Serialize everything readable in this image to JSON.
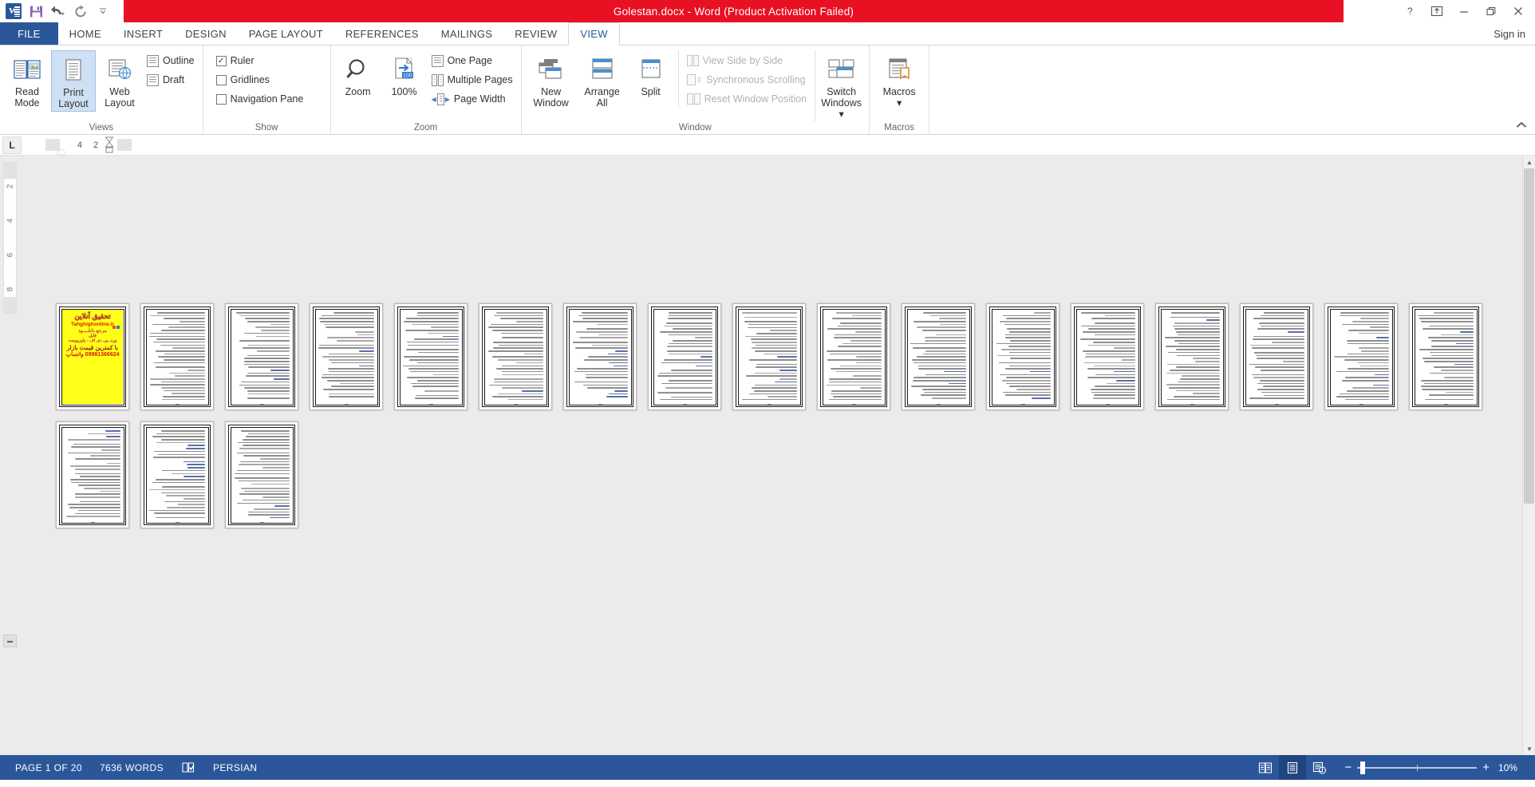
{
  "window": {
    "title": "Golestan.docx  -  Word (Product Activation Failed)",
    "accent_red": "#e81123",
    "accent_blue": "#2b579a",
    "quick_access": [
      {
        "name": "word-logo",
        "label": "W"
      },
      {
        "name": "save-icon",
        "label": "Save"
      },
      {
        "name": "undo-icon",
        "label": "Undo"
      },
      {
        "name": "redo-icon",
        "label": "Redo"
      },
      {
        "name": "customize-qat-icon",
        "label": "Customize Quick Access Toolbar"
      }
    ],
    "controls": [
      {
        "name": "help-button",
        "label": "?"
      },
      {
        "name": "ribbon-display-options-button",
        "label": "Ribbon Display Options"
      },
      {
        "name": "minimize-button",
        "label": "Minimize"
      },
      {
        "name": "restore-button",
        "label": "Restore Down"
      },
      {
        "name": "close-button",
        "label": "Close"
      }
    ],
    "sign_in": "Sign in"
  },
  "tabs": [
    {
      "label": "FILE",
      "active": false,
      "file": true
    },
    {
      "label": "HOME",
      "active": false
    },
    {
      "label": "INSERT",
      "active": false
    },
    {
      "label": "DESIGN",
      "active": false
    },
    {
      "label": "PAGE LAYOUT",
      "active": false
    },
    {
      "label": "REFERENCES",
      "active": false
    },
    {
      "label": "MAILINGS",
      "active": false
    },
    {
      "label": "REVIEW",
      "active": false
    },
    {
      "label": "VIEW",
      "active": true
    }
  ],
  "ribbon": {
    "collapse_label": "Collapse the Ribbon",
    "groups": {
      "views": {
        "label": "Views",
        "buttons": [
          {
            "label_line1": "Read",
            "label_line2": "Mode",
            "icon": "read-mode-icon",
            "selected": false
          },
          {
            "label_line1": "Print",
            "label_line2": "Layout",
            "icon": "print-layout-icon",
            "selected": true
          },
          {
            "label_line1": "Web",
            "label_line2": "Layout",
            "icon": "web-layout-icon",
            "selected": false
          }
        ],
        "small": [
          {
            "label": "Outline",
            "icon": "outline-icon"
          },
          {
            "label": "Draft",
            "icon": "draft-icon"
          }
        ]
      },
      "show": {
        "label": "Show",
        "checkboxes": [
          {
            "label": "Ruler",
            "checked": true
          },
          {
            "label": "Gridlines",
            "checked": false
          },
          {
            "label": "Navigation Pane",
            "checked": false
          }
        ]
      },
      "zoom": {
        "label": "Zoom",
        "buttons": [
          {
            "label": "Zoom",
            "icon": "magnifier-icon"
          },
          {
            "label": "100%",
            "icon": "zoom-100-icon"
          }
        ],
        "small": [
          {
            "label": "One Page",
            "icon": "one-page-icon"
          },
          {
            "label": "Multiple Pages",
            "icon": "multiple-pages-icon"
          },
          {
            "label": "Page Width",
            "icon": "page-width-icon"
          }
        ]
      },
      "window": {
        "label": "Window",
        "buttons": [
          {
            "label_line1": "New",
            "label_line2": "Window",
            "icon": "new-window-icon"
          },
          {
            "label_line1": "Arrange",
            "label_line2": "All",
            "icon": "arrange-all-icon"
          },
          {
            "label_line1": "Split",
            "label_line2": "",
            "icon": "split-icon"
          }
        ],
        "small": [
          {
            "label": "View Side by Side",
            "icon": "view-side-by-side-icon",
            "disabled": true
          },
          {
            "label": "Synchronous Scrolling",
            "icon": "synchronous-scrolling-icon",
            "disabled": true
          },
          {
            "label": "Reset Window Position",
            "icon": "reset-window-position-icon",
            "disabled": true
          }
        ],
        "switch_windows": {
          "label_line1": "Switch",
          "label_line2": "Windows",
          "icon": "switch-windows-icon"
        }
      },
      "macros": {
        "label": "Macros",
        "button": {
          "label": "Macros",
          "icon": "macros-icon"
        }
      }
    }
  },
  "ruler": {
    "tab_selector": "L",
    "marks": [
      "4",
      "2"
    ]
  },
  "vertical_ruler": {
    "marks": [
      "2",
      "4",
      "6",
      "8"
    ]
  },
  "document": {
    "cover": {
      "title": "تحقیق آنلاین",
      "site": "Tahghighonline.ir",
      "line3": "مرجع دانلــــود",
      "line4": "فایل",
      "line5": "وردـ پی دی اف - پاورپوینت",
      "line6": "با کمترین قیمت بازار",
      "line7": "09981366624 واتساپ",
      "background": "#ffff1a",
      "text_color": "#c0392b"
    },
    "page_count": 20,
    "row1_pages": 17,
    "row2_pages": 3
  },
  "statusbar": {
    "page": "PAGE 1 OF 20",
    "words": "7636 WORDS",
    "proofing_icon": "proofing-errors-icon",
    "language": "PERSIAN",
    "views": [
      {
        "name": "read-mode-view-button",
        "label": "Read Mode",
        "active": false
      },
      {
        "name": "print-layout-view-button",
        "label": "Print Layout",
        "active": true
      },
      {
        "name": "web-layout-view-button",
        "label": "Web Layout",
        "active": false
      }
    ],
    "zoom_out": "−",
    "zoom_in": "+",
    "zoom_level": "10%"
  }
}
